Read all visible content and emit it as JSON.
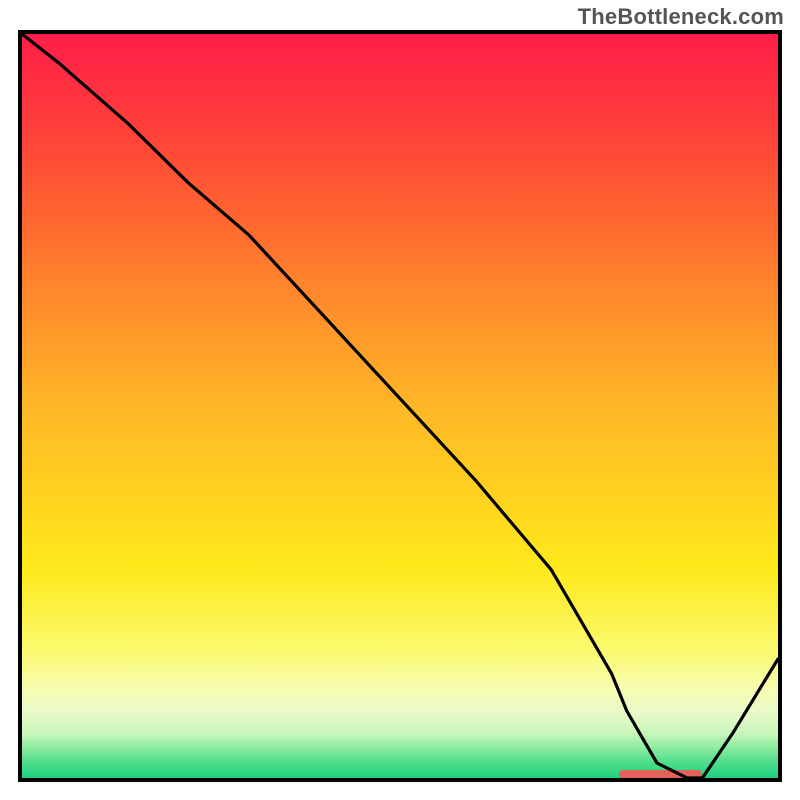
{
  "watermark": "TheBottleneck.com",
  "colors": {
    "border": "#000000",
    "line": "#000000",
    "marker": "#E5625A"
  },
  "chart_data": {
    "type": "line",
    "title": "",
    "xlabel": "",
    "ylabel": "",
    "xlim": [
      0,
      100
    ],
    "ylim": [
      0,
      100
    ],
    "marker_range": [
      79,
      90
    ],
    "series": [
      {
        "name": "curve",
        "x": [
          0,
          5,
          14,
          22,
          30,
          40,
          50,
          60,
          70,
          78,
          80,
          84,
          88,
          90,
          94,
          100
        ],
        "values": [
          100,
          96,
          88,
          80,
          73,
          62,
          51,
          40,
          28,
          14,
          9,
          2,
          0,
          0,
          6,
          16
        ]
      }
    ]
  }
}
